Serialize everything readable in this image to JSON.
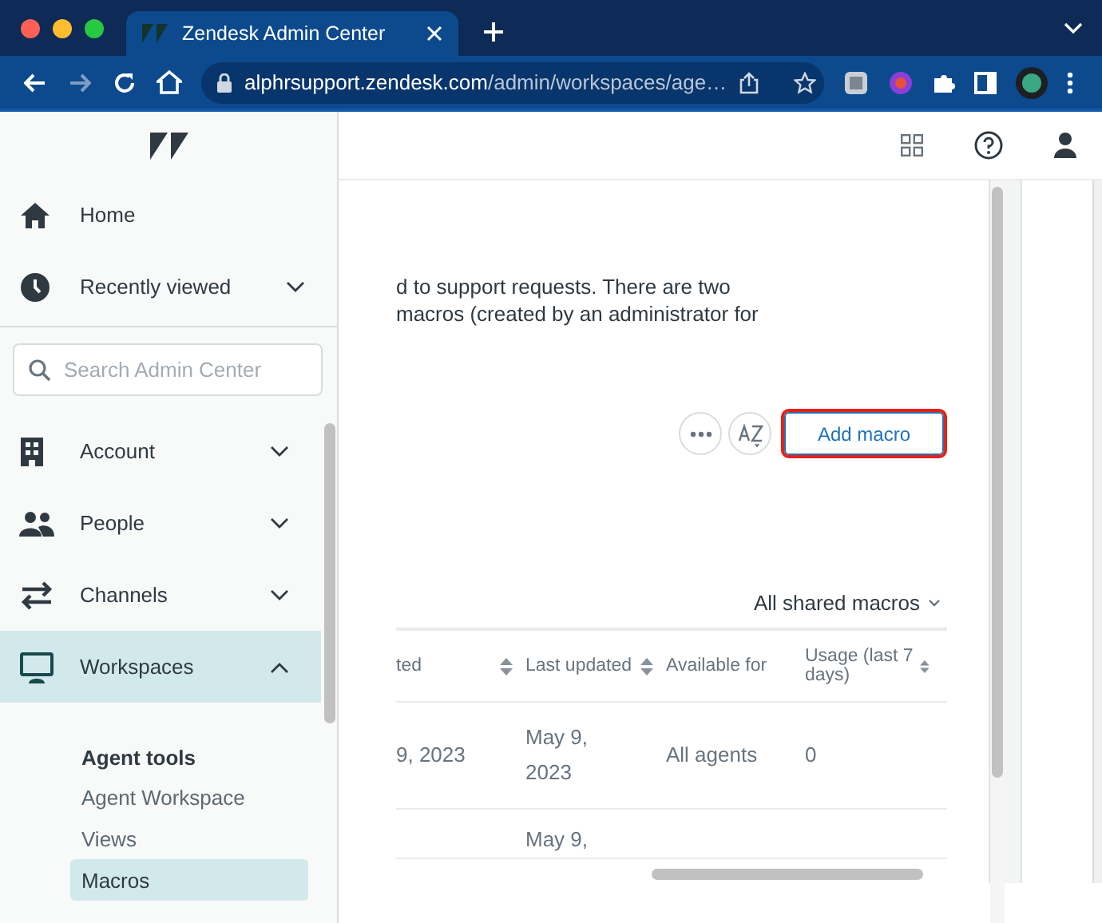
{
  "browser": {
    "tab_title": "Zendesk Admin Center",
    "url_host": "alphrsupport.zendesk.com",
    "url_path": "/admin/workspaces/age…"
  },
  "sidebar": {
    "top_items": [
      {
        "label": "Home",
        "kind": "link"
      },
      {
        "label": "Recently viewed",
        "kind": "group",
        "expanded": false
      }
    ],
    "search": {
      "placeholder": "Search Admin Center"
    },
    "nav_items": [
      {
        "label": "Account",
        "kind": "group",
        "expanded": false,
        "selected": false
      },
      {
        "label": "People",
        "kind": "group",
        "expanded": false,
        "selected": false
      },
      {
        "label": "Channels",
        "kind": "group",
        "expanded": false,
        "selected": false
      },
      {
        "label": "Workspaces",
        "kind": "group",
        "expanded": true,
        "selected": true
      }
    ],
    "subnav": {
      "heading": "Agent tools",
      "items": [
        {
          "label": "Agent Workspace",
          "selected": false
        },
        {
          "label": "Views",
          "selected": false
        },
        {
          "label": "Macros",
          "selected": true
        }
      ]
    }
  },
  "content": {
    "description": [
      "d to support requests. There are two",
      "macros (created by an administrator for"
    ],
    "add_button": {
      "label": "Add macro",
      "highlighted": true
    },
    "filter": {
      "label": "All shared macros"
    },
    "table": {
      "columns": [
        {
          "label": "ted",
          "sortable": true
        },
        {
          "label": "Last updated",
          "sortable": true
        },
        {
          "label": "Available for",
          "sortable": false
        },
        {
          "label": "Usage (last 7 days)",
          "sortable": true
        }
      ],
      "rows": [
        [
          "9, 2023",
          "May 9, 2023",
          "All agents",
          "0"
        ],
        [
          "",
          "May 9,",
          "",
          ""
        ]
      ]
    }
  }
}
